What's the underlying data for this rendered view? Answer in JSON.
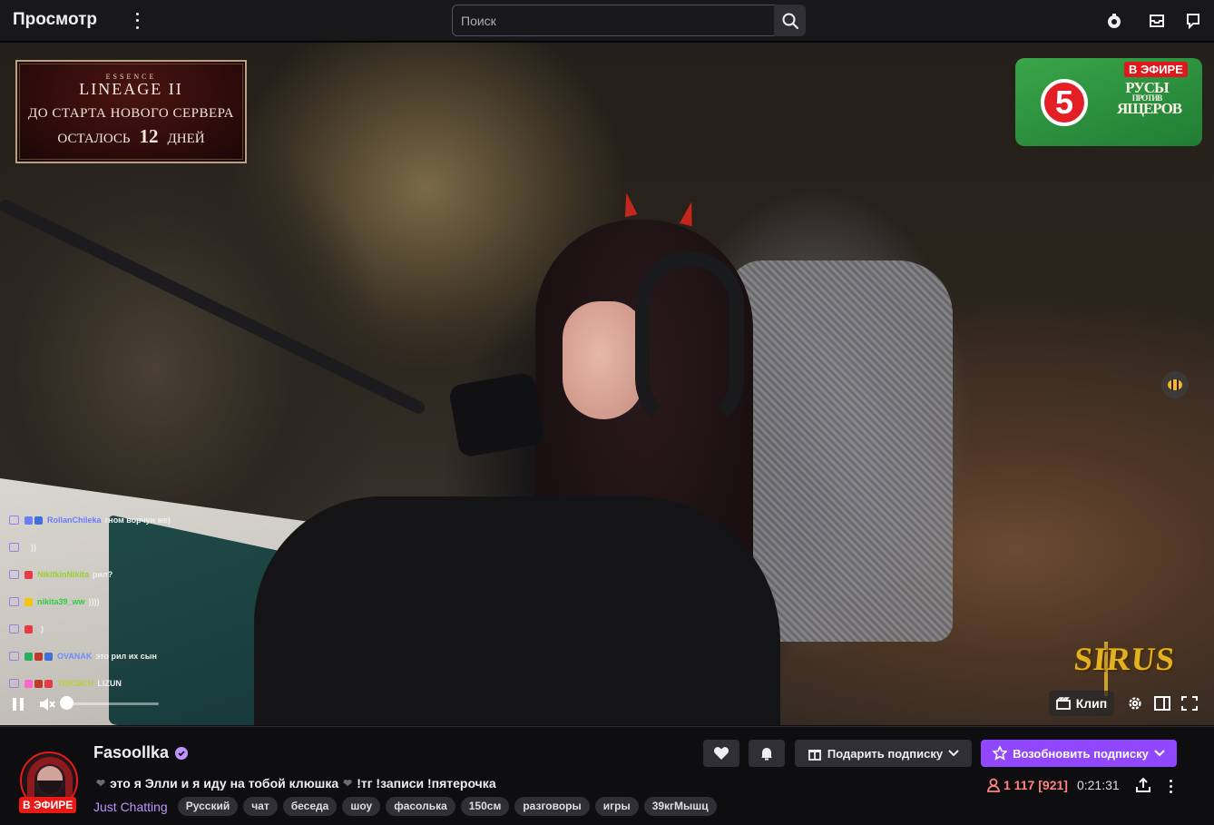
{
  "topbar": {
    "title": "Просмотр",
    "search_placeholder": "Поиск"
  },
  "video": {
    "promo": {
      "brand_small": "ESSENCE",
      "brand": "LINEAGE II",
      "line1": "ДО СТАРТА НОВОГО СЕРВЕРА",
      "line2_pre": "ОСТАЛОСЬ",
      "line2_num": "12",
      "line2_post": "ДНЕЙ"
    },
    "channel_badge": {
      "live": "В ЭФИРЕ",
      "channel_number": "5",
      "show_top": "РУСЫ",
      "show_mid": "ПРОТИВ",
      "show_bottom": "ЯЩЕРОВ"
    },
    "sponsor": "SIRUS",
    "chat": [
      {
        "user": "RollanChileka",
        "message": "гном ворчун же)",
        "color": "#6b7cff",
        "badges": [
          "#6b7cff",
          "#3f6fd8"
        ]
      },
      {
        "user": "",
        "message": "))",
        "color": "#e0404a",
        "badges": []
      },
      {
        "user": "NikitkinNikita",
        "message": "рил?",
        "color": "#9acd32",
        "badges": [
          "#e83a46"
        ]
      },
      {
        "user": "nikita39_ww",
        "message": "))))",
        "color": "#2ecc40",
        "badges": [
          "#f1c40f"
        ]
      },
      {
        "user": "",
        "message": ")",
        "color": "#e0404a",
        "badges": [
          "#e83a46"
        ]
      },
      {
        "user": "OVANAK",
        "message": "это рил их сын",
        "color": "#6f8cff",
        "badges": [
          "#27ae60",
          "#c0392b",
          "#3f6fd8"
        ]
      },
      {
        "user": "TOKSICH",
        "message": "LIZUN",
        "color": "#b8d335",
        "badges": [
          "#ff66cc",
          "#c0392b",
          "#e83a46"
        ]
      }
    ],
    "clip_label": "Клип"
  },
  "stream": {
    "channel_name": "Fasoollka",
    "live_label": "В ЭФИРЕ",
    "title": "это я Элли и я иду на тобой клюшка",
    "title_suffix": "!тг !записи !пятерочка",
    "category": "Just Chatting",
    "tags": [
      "Русский",
      "чат",
      "беседа",
      "шоу",
      "фасолька",
      "150см",
      "разговоры",
      "игры",
      "39кгМышц"
    ],
    "gift_label": "Подарить подписку",
    "subscribe_label": "Возобновить подписку",
    "viewers": "1 117",
    "viewers_extra": "[921]",
    "uptime": "0:21:31"
  },
  "colors": {
    "accent": "#9147ff",
    "live": "#e91916",
    "category": "#bf94ff",
    "viewers": "#ff8280"
  },
  "icons": [
    "kebab-icon",
    "search-icon",
    "prime-loot-icon",
    "inbox-icon",
    "whispers-icon",
    "pause-icon",
    "mute-icon",
    "clip-icon",
    "settings-icon",
    "theatre-mode-icon",
    "fullscreen-icon",
    "heart-icon",
    "bell-icon",
    "gift-icon",
    "star-icon",
    "chevron-down-icon",
    "viewer-icon",
    "share-icon",
    "more-icon"
  ]
}
